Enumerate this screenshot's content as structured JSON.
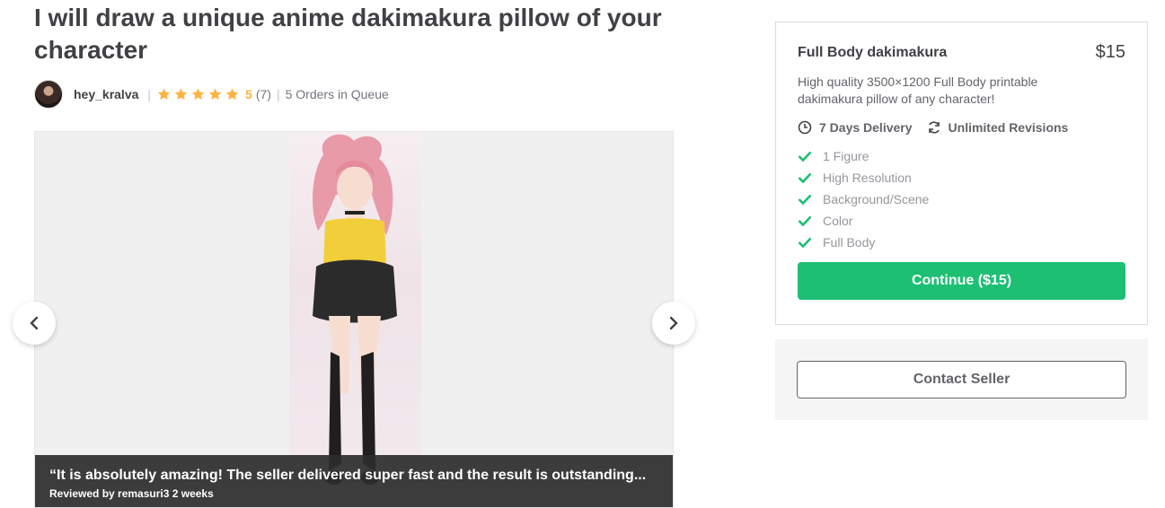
{
  "gig": {
    "title": "I will draw a unique anime dakimakura pillow of your character"
  },
  "seller": {
    "name": "hey_kralva",
    "rating": "5",
    "rating_count": "(7)",
    "queue": "5 Orders in Queue",
    "stars": 5
  },
  "gallery": {
    "review_quote": "“It is absolutely amazing! The seller delivered super fast and the result is outstanding...",
    "review_by": "Reviewed by remasuri3 2 weeks",
    "prev_icon": "chevron-left-icon",
    "next_icon": "chevron-right-icon"
  },
  "package": {
    "title": "Full Body dakimakura",
    "price": "$15",
    "description": "High quality 3500×1200 Full Body printable dakimakura pillow of any character!",
    "delivery": "7 Days Delivery",
    "revisions": "Unlimited Revisions",
    "features": [
      "1 Figure",
      "High Resolution",
      "Background/Scene",
      "Color",
      "Full Body"
    ],
    "continue_label": "Continue ($15)"
  },
  "contact": {
    "label": "Contact Seller"
  },
  "colors": {
    "accent_green": "#1dbf73",
    "star_gold": "#ffb33e",
    "text_dark": "#404145"
  }
}
